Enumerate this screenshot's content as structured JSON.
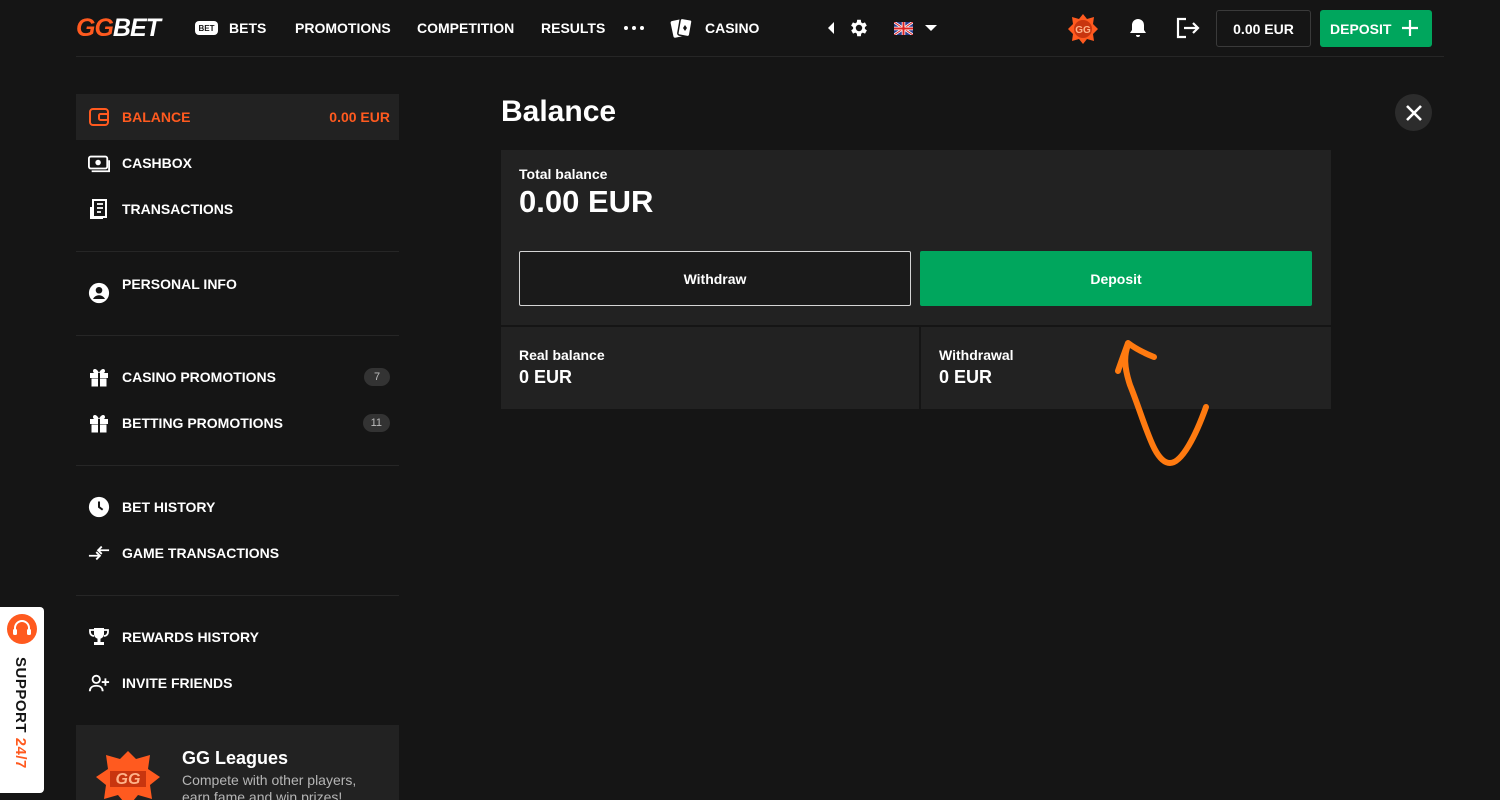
{
  "header": {
    "logo_gg": "GG",
    "logo_bet": "BET",
    "bet_pill": "BET",
    "nav": {
      "bets": "BETS",
      "promotions": "PROMOTIONS",
      "competition": "COMPETITION",
      "results": "RESULTS",
      "casino": "CASINO"
    },
    "balance": "0.00 EUR",
    "deposit": "DEPOSIT"
  },
  "sidebar": {
    "balance_label": "BALANCE",
    "balance_value": "0.00 EUR",
    "cashbox": "CASHBOX",
    "transactions": "TRANSACTIONS",
    "personal_info": "PERSONAL INFO",
    "casino_promotions": "CASINO PROMOTIONS",
    "casino_promotions_count": "7",
    "betting_promotions": "BETTING PROMOTIONS",
    "betting_promotions_count": "11",
    "bet_history": "BET HISTORY",
    "game_transactions": "GAME TRANSACTIONS",
    "rewards_history": "REWARDS HISTORY",
    "invite_friends": "INVITE FRIENDS"
  },
  "leagues": {
    "title": "GG Leagues",
    "text": "Compete with other players, earn fame and win prizes!"
  },
  "main": {
    "title": "Balance",
    "total_label": "Total balance",
    "total_value": "0.00 EUR",
    "withdraw": "Withdraw",
    "deposit": "Deposit",
    "real_label": "Real balance",
    "real_value": "0 EUR",
    "withdrawal_label": "Withdrawal",
    "withdrawal_value": "0 EUR"
  },
  "support": {
    "word": "SUPPORT",
    "hours": "24/7"
  },
  "colors": {
    "accent": "#ff5a1f",
    "green": "#00a65d",
    "background": "#151515",
    "panel": "#222222"
  }
}
